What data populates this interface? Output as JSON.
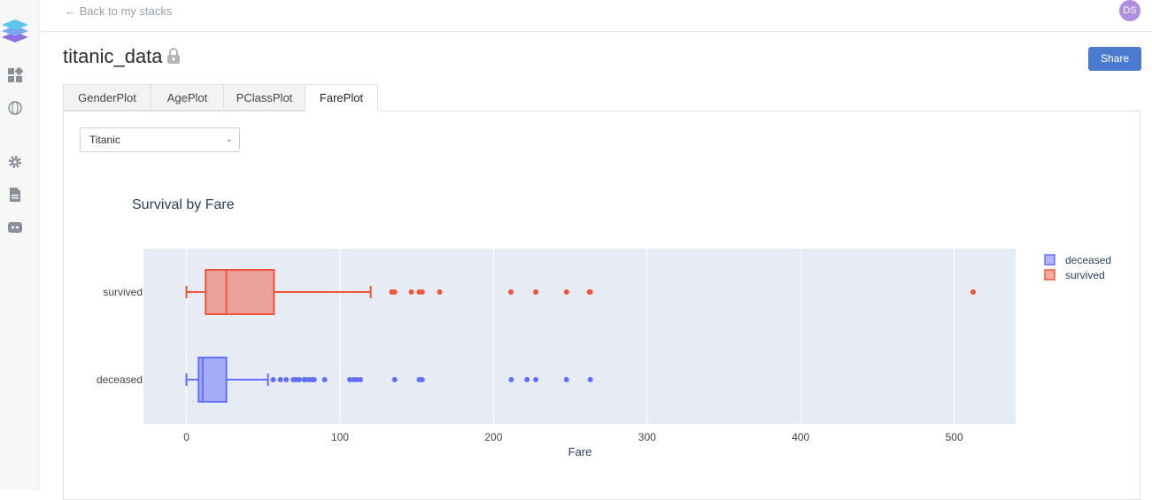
{
  "nav": {
    "back_label": "← Back to my stacks",
    "avatar_initials": "DS"
  },
  "sidebar": {
    "icons": [
      "dashboard-icon",
      "globe-icon",
      "gear-icon",
      "document-icon",
      "discord-icon"
    ]
  },
  "page": {
    "title": "titanic_data",
    "share_label": "Share"
  },
  "tabs": [
    {
      "label": "GenderPlot",
      "active": false
    },
    {
      "label": "AgePlot",
      "active": false
    },
    {
      "label": "PClassPlot",
      "active": false
    },
    {
      "label": "FarePlot",
      "active": true
    }
  ],
  "dataset_select": {
    "value": "Titanic"
  },
  "colors": {
    "deceased": "#636efa",
    "survived": "#ef553b",
    "plot_bg": "#e5ecf6",
    "accent": "#4a7bd0"
  },
  "chart_data": {
    "type": "box",
    "title": "Survival by Fare",
    "xlabel": "Fare",
    "ylabel": "",
    "orientation": "horizontal",
    "xlim": [
      -28,
      540
    ],
    "xticks": [
      0,
      100,
      200,
      300,
      400,
      500
    ],
    "grid": true,
    "legend": "top-right",
    "categories": [
      "deceased",
      "survived"
    ],
    "series": [
      {
        "name": "deceased",
        "color": "#636efa",
        "whisker_low": 0,
        "q1": 7.9,
        "median": 10.5,
        "q3": 26,
        "whisker_high": 53.1,
        "outliers": [
          56.5,
          61.2,
          65,
          69.6,
          71.3,
          73.5,
          76.7,
          77.3,
          79.7,
          81.9,
          83.2,
          90,
          106.4,
          108.9,
          110.9,
          113.3,
          135.6,
          151.6,
          153.5,
          211.5,
          221.8,
          227.5,
          247.5,
          263
        ]
      },
      {
        "name": "survived",
        "color": "#ef553b",
        "whisker_low": 0,
        "q1": 12.5,
        "median": 26,
        "q3": 57,
        "whisker_high": 120,
        "outliers": [
          133.7,
          134.5,
          135.6,
          146.5,
          151.6,
          153.5,
          164.9,
          211.3,
          227.5,
          247.5,
          262.4,
          263,
          512.3
        ]
      }
    ]
  }
}
